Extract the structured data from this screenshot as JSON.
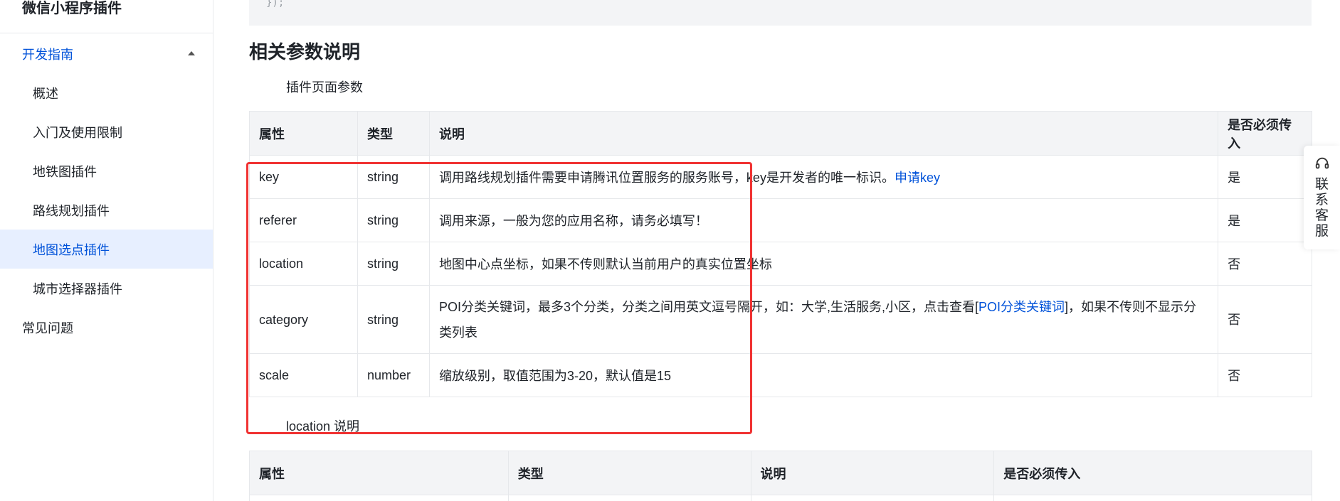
{
  "sidebar": {
    "title": "微信小程序插件",
    "group_label": "开发指南",
    "items": [
      {
        "label": "概述"
      },
      {
        "label": "入门及使用限制"
      },
      {
        "label": "地铁图插件"
      },
      {
        "label": "路线规划插件"
      },
      {
        "label": "地图选点插件",
        "active": true
      },
      {
        "label": "城市选择器插件"
      }
    ],
    "faq_label": "常见问题"
  },
  "code_tail": "});",
  "section": {
    "heading": "相关参数说明",
    "subheading": "插件页面参数",
    "subheading2": "location 说明"
  },
  "table1": {
    "headers": [
      "属性",
      "类型",
      "说明",
      "是否必须传入"
    ],
    "rows": [
      {
        "attr": "key",
        "type": "string",
        "desc": "调用路线规划插件需要申请腾讯位置服务的服务账号，key是开发者的唯一标识。",
        "link": "申请key",
        "required": "是"
      },
      {
        "attr": "referer",
        "type": "string",
        "desc": "调用来源，一般为您的应用名称，请务必填写！",
        "required": "是"
      },
      {
        "attr": "location",
        "type": "string",
        "desc": "地图中心点坐标，如果不传则默认当前用户的真实位置坐标",
        "required": "否"
      },
      {
        "attr": "category",
        "type": "string",
        "desc_pre": "POI分类关键词，最多3个分类，分类之间用英文逗号隔开，如：大学,生活服务,小区，点击查看[",
        "link": "POI分类关键词",
        "desc_post": "]，如果不传则不显示分类列表",
        "required": "否"
      },
      {
        "attr": "scale",
        "type": "number",
        "desc": "缩放级别，取值范围为3-20，默认值是15",
        "required": "否"
      }
    ]
  },
  "table2": {
    "headers": [
      "属性",
      "类型",
      "说明",
      "是否必须传入"
    ]
  },
  "float_tab": {
    "icon": "headset-icon",
    "label": "联系客服"
  },
  "colors": {
    "accent": "#0052d9",
    "active_bg": "#e7efff",
    "highlight": "#f03232"
  }
}
